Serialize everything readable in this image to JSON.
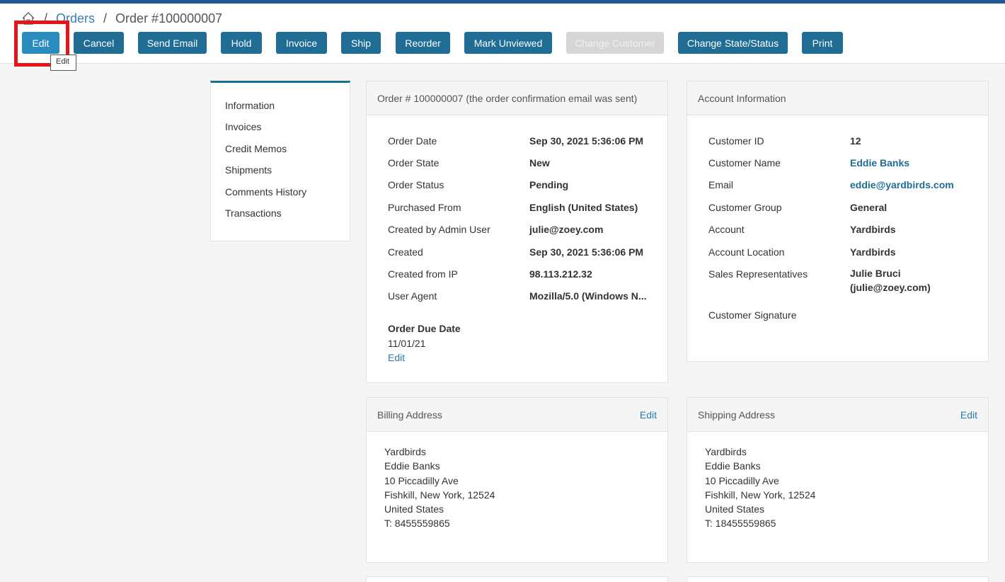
{
  "breadcrumb": {
    "orders": "Orders",
    "separator": "/",
    "current": "Order #100000007"
  },
  "actions": {
    "edit": "Edit",
    "cancel": "Cancel",
    "send_email": "Send Email",
    "hold": "Hold",
    "invoice": "Invoice",
    "ship": "Ship",
    "reorder": "Reorder",
    "mark_unviewed": "Mark Unviewed",
    "change_customer": "Change Customer",
    "change_state": "Change State/Status",
    "print": "Print"
  },
  "tooltip": "Edit",
  "sidebar": {
    "items": [
      "Information",
      "Invoices",
      "Credit Memos",
      "Shipments",
      "Comments History",
      "Transactions"
    ]
  },
  "order_info": {
    "title": "Order # 100000007 (the order confirmation email was sent)",
    "rows": [
      {
        "label": "Order Date",
        "value": "Sep 30, 2021 5:36:06 PM"
      },
      {
        "label": "Order State",
        "value": "New"
      },
      {
        "label": "Order Status",
        "value": "Pending"
      },
      {
        "label": "Purchased From",
        "value": "English (United States)"
      },
      {
        "label": "Created by Admin User",
        "value": "julie@zoey.com"
      },
      {
        "label": "Created",
        "value": "Sep 30, 2021 5:36:06 PM"
      },
      {
        "label": "Created from IP",
        "value": "98.113.212.32"
      },
      {
        "label": "User Agent",
        "value": "Mozilla/5.0 (Windows N..."
      }
    ],
    "due_date_label": "Order Due Date",
    "due_date_value": "11/01/21",
    "due_date_edit": "Edit"
  },
  "account_info": {
    "title": "Account Information",
    "rows": [
      {
        "label": "Customer ID",
        "value": "12"
      },
      {
        "label": "Customer Name",
        "value": "Eddie Banks"
      },
      {
        "label": "Email",
        "value": "eddie@yardbirds.com"
      },
      {
        "label": "Customer Group",
        "value": "General"
      },
      {
        "label": "Account",
        "value": "Yardbirds"
      },
      {
        "label": "Account Location",
        "value": "Yardbirds"
      },
      {
        "label": "Sales Representatives",
        "value": "Julie Bruci",
        "value2": "(julie@zoey.com)"
      },
      {
        "label": "Customer Signature",
        "value": ""
      }
    ]
  },
  "billing": {
    "title": "Billing Address",
    "edit": "Edit",
    "lines": [
      "Yardbirds",
      "Eddie Banks",
      "10 Piccadilly Ave",
      "Fishkill, New York, 12524",
      "United States",
      "T: 8455559865"
    ]
  },
  "shipping": {
    "title": "Shipping Address",
    "edit": "Edit",
    "lines": [
      "Yardbirds",
      "Eddie Banks",
      "10 Piccadilly Ave",
      "Fishkill, New York, 12524",
      "United States",
      "T: 18455559865"
    ]
  },
  "colors": {
    "primary_button": "#1f6c94",
    "highlight": "#e3141a",
    "link": "#2a7ab0"
  }
}
